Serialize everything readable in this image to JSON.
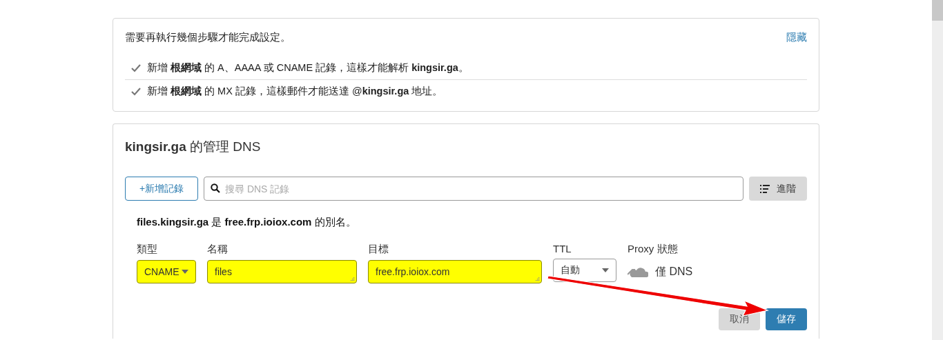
{
  "setup_notice": {
    "title": "需要再執行幾個步驟才能完成設定。",
    "hide_link": "隱藏",
    "steps": [
      {
        "text": "新增 **根網域** 的 A、AAAA 或 CNAME 記錄，這樣才能解析 **kingsir.ga**。",
        "done": true
      },
      {
        "text": "新增 **根網域** 的 MX 記錄，這樣郵件才能送達 @**kingsir.ga** 地址。",
        "done": true
      }
    ]
  },
  "dns": {
    "title": "**kingsir.ga** 的管理 DNS",
    "add_button": "+新增記錄",
    "search": {
      "placeholder": "搜尋 DNS 記錄"
    },
    "advanced_button": "進階",
    "alias_note": "**files.kingsir.ga** 是 **free.frp.ioiox.com** 的別名。",
    "fields": [
      {
        "label": "類型",
        "kind": "select",
        "value": "CNAME",
        "highlighted": true
      },
      {
        "label": "名稱",
        "kind": "text",
        "value": "files",
        "highlighted": true
      },
      {
        "label": "目標",
        "kind": "text",
        "value": "free.frp.ioiox.com",
        "highlighted": true
      },
      {
        "label": "TTL",
        "kind": "select",
        "value": "自動",
        "highlighted": false
      },
      {
        "label": "Proxy 狀態",
        "kind": "proxy",
        "value": "僅 DNS"
      }
    ],
    "buttons": [
      {
        "label": "取消",
        "kind": "secondary"
      },
      {
        "label": "儲存",
        "kind": "primary"
      }
    ]
  },
  "annotation": {
    "kind": "arrow"
  }
}
